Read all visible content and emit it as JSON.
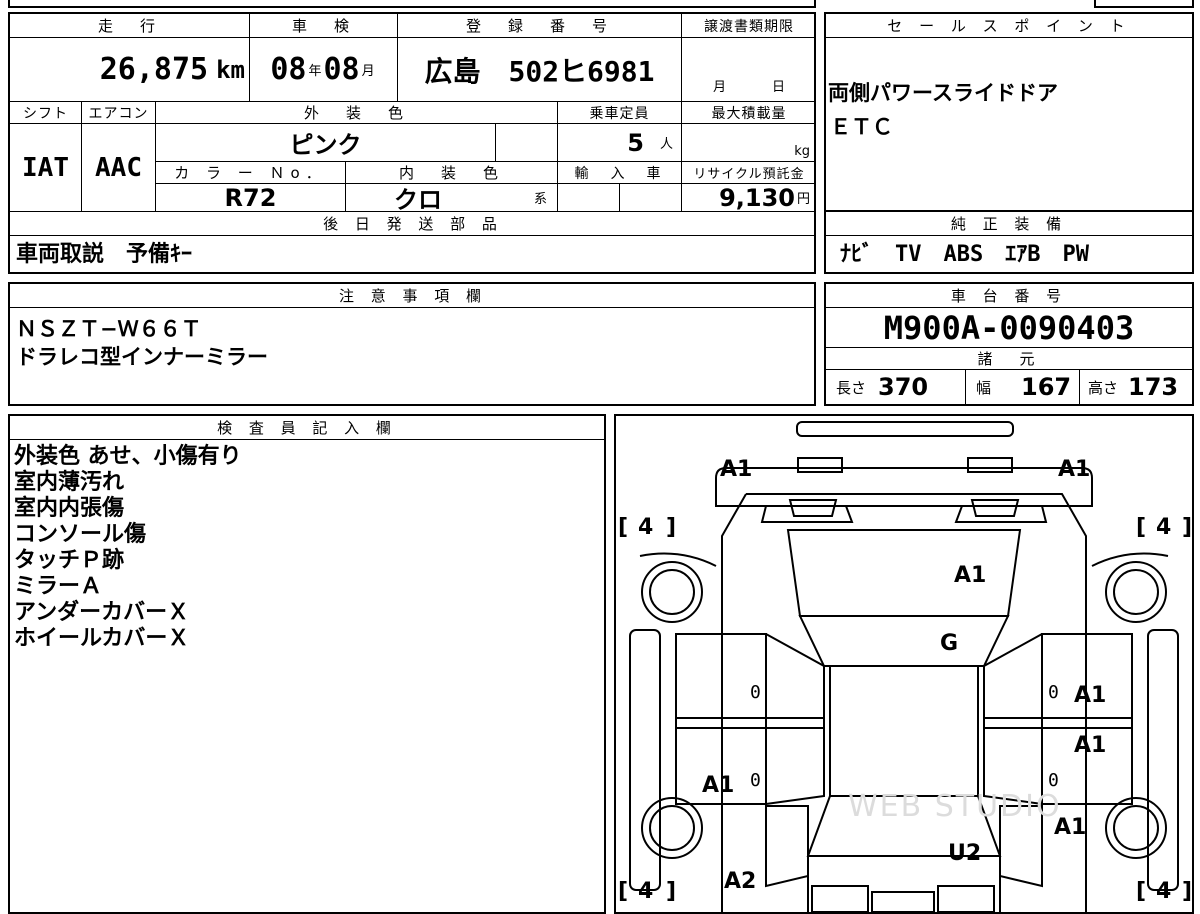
{
  "main": {
    "mileage_label": "走　行",
    "mileage_value": "26,875",
    "mileage_unit": "km",
    "inspection_label": "車　検",
    "inspection_year": "08",
    "inspection_year_unit": "年",
    "inspection_month": "08",
    "inspection_month_unit": "月",
    "reg_label": "登　録　番　号",
    "reg_value": "広島　502ヒ6981",
    "transfer_label": "譲渡書類期限",
    "transfer_month_unit": "月",
    "transfer_day_unit": "日",
    "shift_label": "シフト",
    "shift_value": "IAT",
    "ac_label": "エアコン",
    "ac_value": "AAC",
    "exterior_label": "外　装　色",
    "exterior_value": "ピンク",
    "capacity_label": "乗車定員",
    "capacity_value": "5",
    "capacity_unit": "人",
    "maxload_label": "最大積載量",
    "maxload_unit": "kg",
    "color_no_label": "カ ラ ー Ｎo．",
    "color_no_value": "R72",
    "interior_label": "内　装　色",
    "interior_value": "クロ",
    "interior_suffix": "系",
    "import_label": "輸　入　車",
    "recycle_label": "リサイクル預託金",
    "recycle_value": "9,130",
    "recycle_unit": "円",
    "later_parts_label": "後 日 発 送 部 品",
    "later_parts_value": "車両取説　予備ｷｰ"
  },
  "sales": {
    "label": "セ ー ル ス ポ イ ン ト",
    "lines": [
      "両側パワースライドドア",
      "ＥＴＣ"
    ]
  },
  "equipment": {
    "label": "純 正 装 備",
    "value": "ﾅﾋﾞ　TV　ABS　ｴｱB　PW"
  },
  "notes": {
    "label": "注 意 事 項 欄",
    "lines": [
      "ＮＳＺＴ−Ｗ６６Ｔ",
      "ドラレコ型インナーミラー"
    ]
  },
  "chassis": {
    "label": "車 台 番 号",
    "value": "M900A-0090403",
    "spec_label": "諸　元",
    "length_label": "長さ",
    "length_value": "370",
    "width_label": "幅",
    "width_value": "167",
    "height_label": "高さ",
    "height_value": "173"
  },
  "inspector": {
    "label": "検 査 員 記 入 欄",
    "lines": [
      "外装色 あせ、小傷有り",
      "室内薄汚れ",
      "室内内張傷",
      "コンソール傷",
      "タッチＰ跡",
      "ミラーＡ",
      "アンダーカバーＸ",
      "ホイールカバーＸ"
    ]
  },
  "diagram": {
    "marks": {
      "front_left_corner": "A1",
      "front_right_corner": "A1",
      "hood": "A1",
      "windshield": "G",
      "right_front_door": "A1",
      "right_rear_door": "A1",
      "right_rear_fender": "A1",
      "left_rear_door": "A1",
      "left_rear_fender": "A2",
      "roof_rear": "U2",
      "left_front_door_zero": "0",
      "left_rear_door_zero": "0",
      "right_front_door_zero": "0",
      "right_rear_door_zero": "0"
    },
    "tires": {
      "front_left": "4",
      "front_right": "4",
      "rear_left": "4",
      "rear_right": "4"
    },
    "watermark": "WEB STUDIO"
  }
}
